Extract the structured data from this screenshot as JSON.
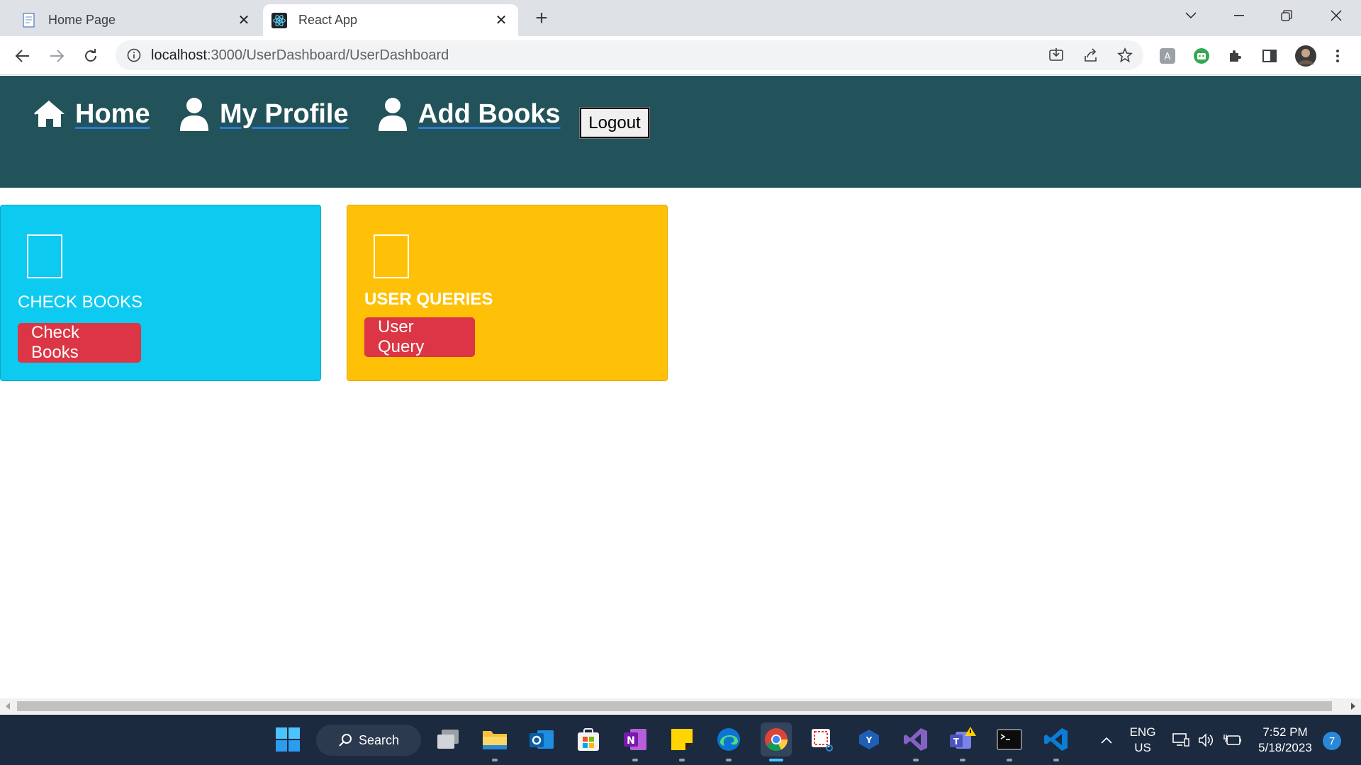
{
  "browser": {
    "tabs": [
      {
        "title": "Home Page",
        "active": false
      },
      {
        "title": "React App",
        "active": true
      }
    ],
    "url_host": "localhost",
    "url_path": ":3000/UserDashboard/UserDashboard"
  },
  "navbar": {
    "home_label": "Home",
    "profile_label": "My Profile",
    "add_books_label": "Add Books",
    "logout_label": "Logout",
    "background": "#22525a"
  },
  "cards": {
    "check_books": {
      "title": "CHECK BOOKS",
      "button": "Check Books",
      "color": "#0dcaf0"
    },
    "user_queries": {
      "title": "USER QUERIES",
      "button": "User Query",
      "color": "#ffc107"
    },
    "button_color": "#dc3545"
  },
  "taskbar": {
    "search_label": "Search",
    "lang_line1": "ENG",
    "lang_line2": "US",
    "time": "7:52 PM",
    "date": "5/18/2023",
    "notification_count": "7"
  }
}
